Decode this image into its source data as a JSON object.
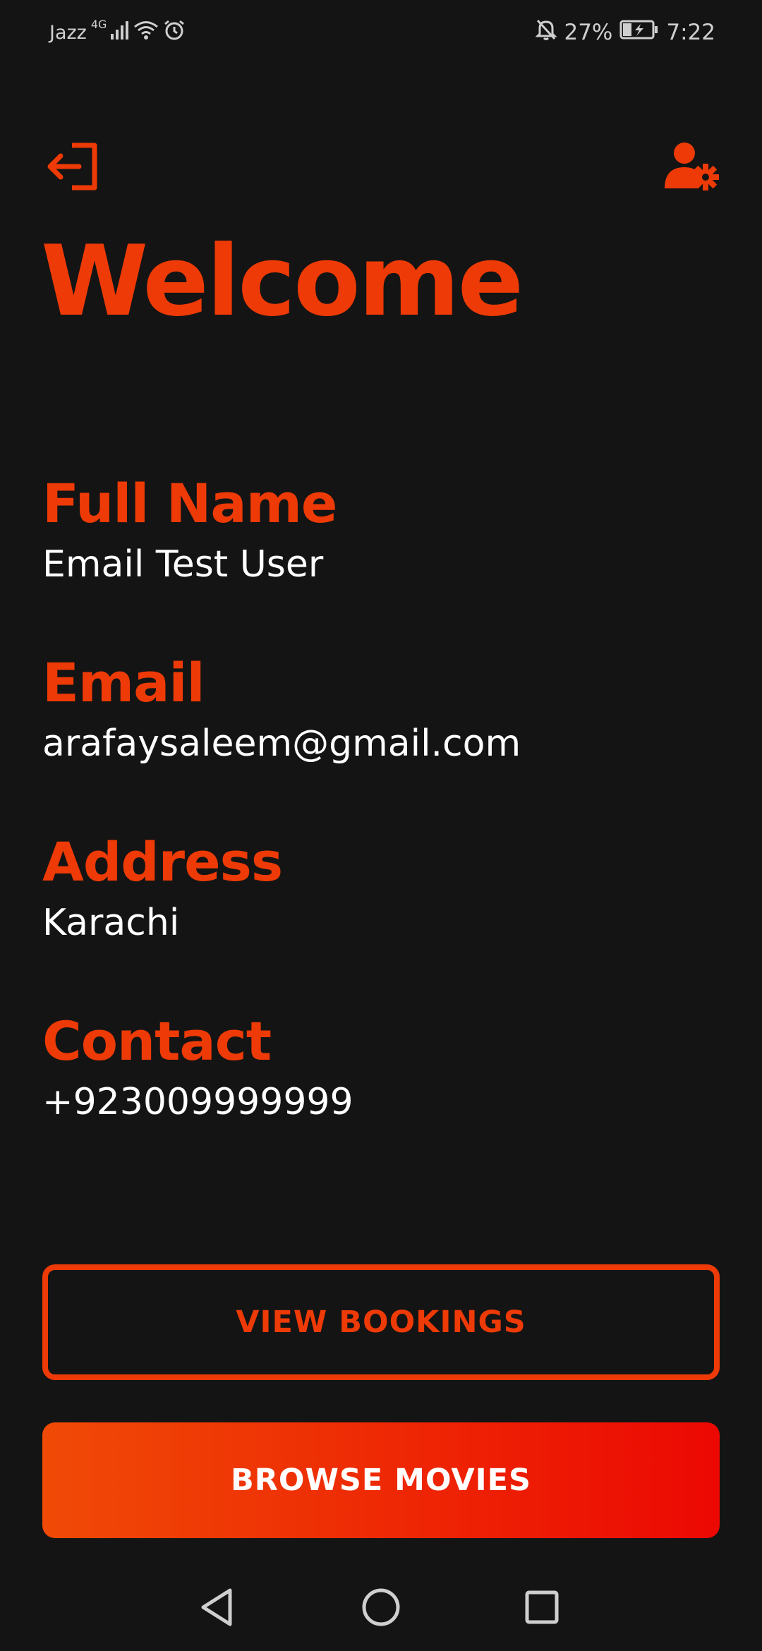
{
  "status_bar": {
    "carrier": "Jazz",
    "network_type": "4G",
    "battery_percent": "27%",
    "time": "7:22",
    "icons": [
      "signal-icon",
      "wifi-icon",
      "alarm-icon",
      "notifications-off-icon",
      "battery-charging-icon"
    ]
  },
  "header": {
    "logout_icon": "logout-icon",
    "user_settings_icon": "user-settings-icon",
    "title": "Welcome"
  },
  "profile": {
    "full_name": {
      "label": "Full Name",
      "value": "Email Test User"
    },
    "email": {
      "label": "Email",
      "value": "arafaysaleem@gmail.com"
    },
    "address": {
      "label": "Address",
      "value": "Karachi"
    },
    "contact": {
      "label": "Contact",
      "value": "+923009999999"
    }
  },
  "actions": {
    "view_bookings_label": "VIEW BOOKINGS",
    "browse_movies_label": "BROWSE MOVIES"
  },
  "colors": {
    "background": "#141414",
    "accent": "#ee3a06",
    "gradient_start": "#f04a06",
    "gradient_end": "#ec0803",
    "text": "#ffffff"
  },
  "nav_bar": {
    "icons": [
      "back-icon",
      "home-icon",
      "recents-icon"
    ]
  }
}
